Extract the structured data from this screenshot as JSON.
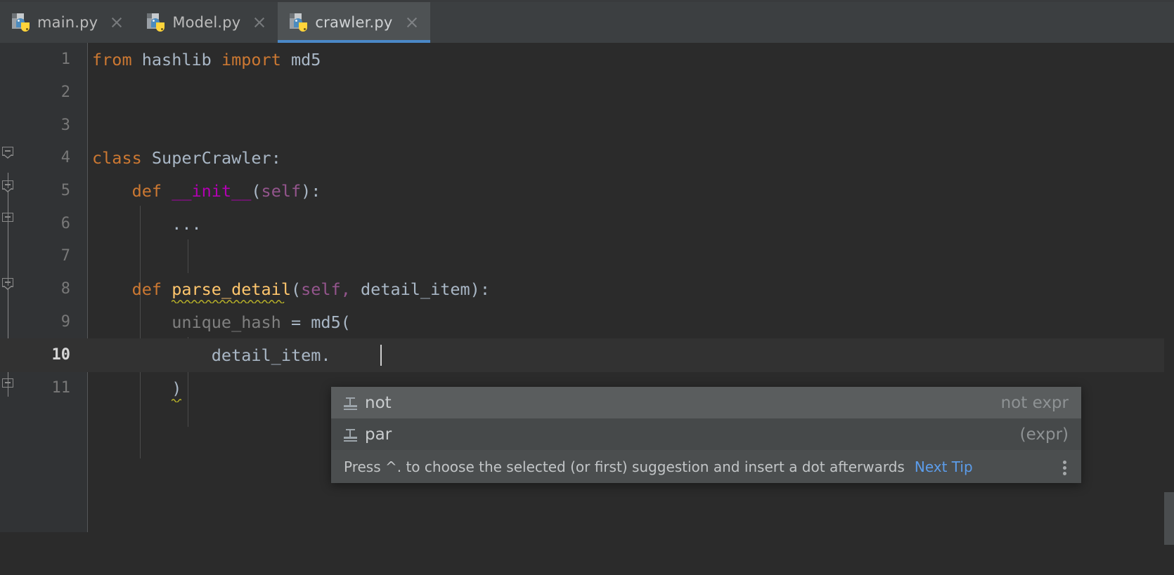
{
  "window": {
    "app": "PyCharm Editor",
    "accent_color": "#4A88C7",
    "background": "#2B2B2B"
  },
  "tabbar": {
    "tabs": [
      {
        "label": "main.py",
        "icon": "python-file-icon",
        "active": false,
        "close_icon": "close-icon"
      },
      {
        "label": "Model.py",
        "icon": "python-file-icon",
        "active": false,
        "close_icon": "close-icon"
      },
      {
        "label": "crawler.py",
        "icon": "python-file-icon",
        "active": true,
        "close_icon": "close-icon"
      }
    ]
  },
  "editor": {
    "language": "Python",
    "current_line": 10,
    "lines": [
      {
        "number": "1",
        "text": "from hashlib import md5"
      },
      {
        "number": "2",
        "text": ""
      },
      {
        "number": "3",
        "text": ""
      },
      {
        "number": "4",
        "text": "class SuperCrawler:"
      },
      {
        "number": "5",
        "text": "    def __init__(self):"
      },
      {
        "number": "6",
        "text": "        ..."
      },
      {
        "number": "7",
        "text": ""
      },
      {
        "number": "8",
        "text": "    def parse_detail(self, detail_item):"
      },
      {
        "number": "9",
        "text": "        unique_hash = md5("
      },
      {
        "number": "10",
        "text": "            detail_item."
      },
      {
        "number": "11",
        "text": "        )"
      }
    ],
    "tokens": {
      "line1": {
        "kw_from": "from",
        "module": "hashlib",
        "kw_import": "import",
        "name": "md5"
      },
      "line4": {
        "kw_class": "class",
        "name": "SuperCrawler",
        "colon": ":"
      },
      "line5": {
        "kw_def": "def",
        "name": "__init__",
        "open": "(",
        "self": "self",
        "close": "):"
      },
      "line6": {
        "ellipsis": "..."
      },
      "line8": {
        "kw_def": "def",
        "name": "parse_detail",
        "open": "(",
        "self": "self",
        "comma": ", ",
        "arg": "detail_item",
        "close": "):"
      },
      "line9": {
        "var": "unique_hash",
        "eq": " = ",
        "call": "md5("
      },
      "line10": {
        "expr": "detail_item."
      },
      "line11": {
        "close": ")"
      }
    },
    "syntax_colors": {
      "keyword": "#CC7832",
      "identifier": "#A9B7C6",
      "function_name": "#FFC66D",
      "magic_method": "#B200B2",
      "self": "#94558D",
      "dim_text": "#808080",
      "warning_squiggle": "#BBB529"
    }
  },
  "autocomplete": {
    "items": [
      {
        "icon": "live-template-icon",
        "label": "not",
        "tail": "not expr",
        "selected": true
      },
      {
        "icon": "live-template-icon",
        "label": "par",
        "tail": "(expr)",
        "selected": false
      }
    ],
    "hint": {
      "text": "Press ^. to choose the selected (or first) suggestion and insert a dot afterwards",
      "link": "Next Tip",
      "more_icon": "more-vertical-icon"
    }
  }
}
